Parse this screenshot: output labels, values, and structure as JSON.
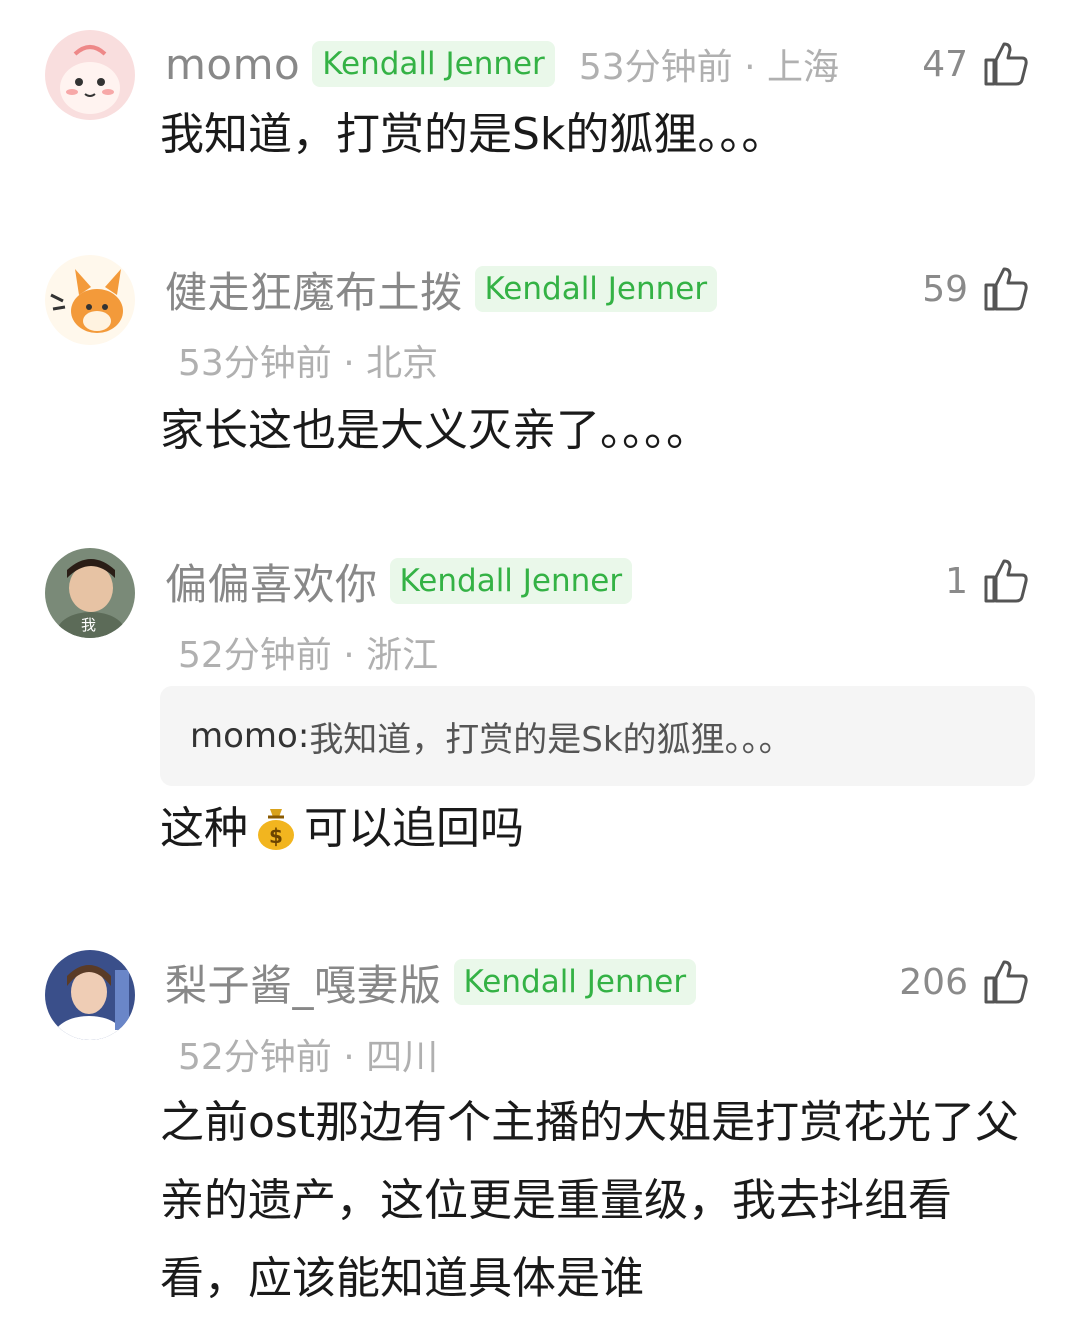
{
  "comments": [
    {
      "username": "momo",
      "badge": "Kendall Jenner",
      "meta": "53分钟前 · 上海",
      "likes": "47",
      "text": "我知道，打赏的是Sk的狐狸。。。"
    },
    {
      "username": "健走狂魔布土拨",
      "badge": "Kendall Jenner",
      "meta": "53分钟前 · 北京",
      "likes": "59",
      "text": "家长这也是大义灭亲了。。。。"
    },
    {
      "username": "偏偏喜欢你",
      "badge": "Kendall Jenner",
      "meta": "52分钟前 · 浙江",
      "likes": "1",
      "avatar_label": "我",
      "quote_user": "momo:",
      "quote_text": " 我知道，打赏的是Sk的狐狸。。。",
      "text_before": "这种",
      "emoji": "money-bag-emoji",
      "text_after": "可以追回吗"
    },
    {
      "username": "梨子酱_嘎妻版",
      "badge": "Kendall Jenner",
      "meta": "52分钟前 · 四川",
      "likes": "206",
      "text": "之前ost那边有个主播的大姐是打赏花光了父亲的遗产，这位更是重量级，我去抖组看看，应该能知道具体是谁"
    }
  ],
  "colors": {
    "badge_bg": "#eaf8ea",
    "badge_text": "#34b245",
    "meta_text": "#b0b0b0",
    "username": "#888888"
  }
}
